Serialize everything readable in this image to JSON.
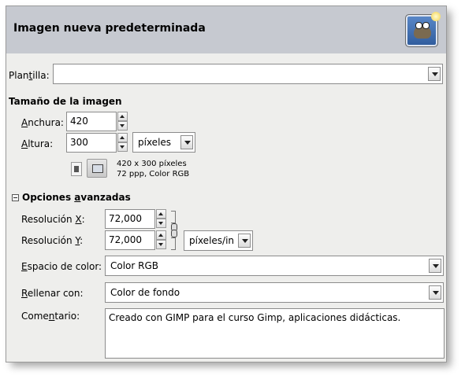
{
  "dialog": {
    "title": "Imagen nueva predeterminada",
    "header_icon": "wilber-gimp-icon"
  },
  "template": {
    "label_pre": "Plan",
    "label_u": "t",
    "label_post": "illa:",
    "value": ""
  },
  "image_size": {
    "heading": "Tamaño de la imagen",
    "width_label_u": "A",
    "width_label_post": "nchura:",
    "width_value": "420",
    "height_label_u": "A",
    "height_label_post": "ltura:",
    "height_value": "300",
    "unit": "píxeles",
    "info_line1": "420 x 300 píxeles",
    "info_line2": "72 ppp, Color RGB"
  },
  "advanced": {
    "heading_pre": "Opciones ",
    "heading_u": "a",
    "heading_post": "vanzadas",
    "res_x_label_pre": "Resolución ",
    "res_x_label_u": "X",
    "res_x_label_post": ":",
    "res_x_value": "72,000",
    "res_y_label_pre": "Resolución ",
    "res_y_label_u": "Y",
    "res_y_label_post": ":",
    "res_y_value": "72,000",
    "res_unit": "píxeles/in",
    "colorspace_label_u": "E",
    "colorspace_label_post": "spacio de color:",
    "colorspace_value": "Color RGB",
    "fill_label_u": "R",
    "fill_label_post": "ellenar con:",
    "fill_value": "Color de fondo",
    "comment_label_pre": "Come",
    "comment_label_u": "n",
    "comment_label_post": "tario:",
    "comment_value": "Creado con GIMP para el curso Gimp, aplicaciones didácticas."
  }
}
